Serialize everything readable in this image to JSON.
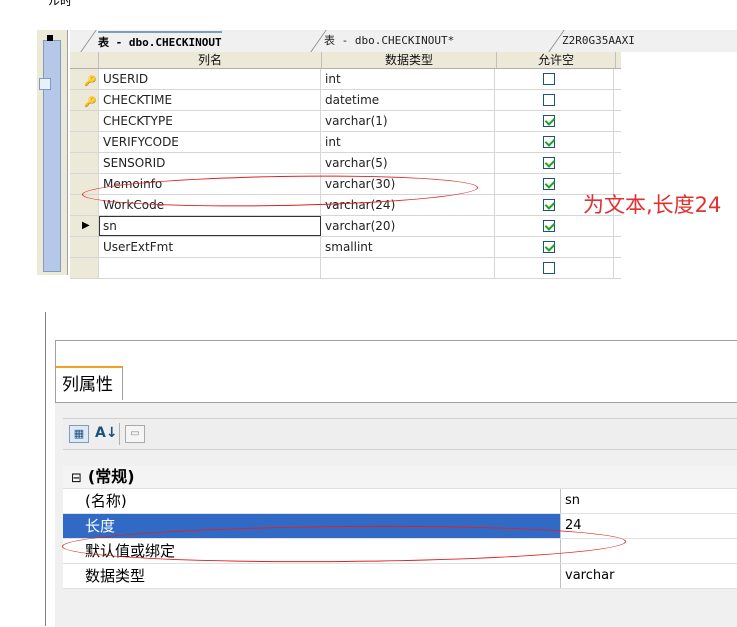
{
  "top_fragment": "ル时",
  "tabs": [
    {
      "label": "表 - dbo.CHECKINOUT",
      "active": true
    },
    {
      "label": "表 - dbo.CHECKINOUT*",
      "active": false
    },
    {
      "label": "Z2R0G35AAXI",
      "active": false
    }
  ],
  "grid": {
    "columns": [
      "列名",
      "数据类型",
      "允许空"
    ],
    "rows": [
      {
        "name": "USERID",
        "type": "int",
        "nullable": false,
        "marker": "key-icon"
      },
      {
        "name": "CHECKTIME",
        "type": "datetime",
        "nullable": false,
        "marker": "key-icon"
      },
      {
        "name": "CHECKTYPE",
        "type": "varchar(1)",
        "nullable": true,
        "marker": ""
      },
      {
        "name": "VERIFYCODE",
        "type": "int",
        "nullable": true,
        "marker": ""
      },
      {
        "name": "SENSORID",
        "type": "varchar(5)",
        "nullable": true,
        "marker": ""
      },
      {
        "name": "Memoinfo",
        "type": "varchar(30)",
        "nullable": true,
        "marker": ""
      },
      {
        "name": "WorkCode",
        "type": "varchar(24)",
        "nullable": true,
        "marker": ""
      },
      {
        "name": "sn",
        "type": "varchar(20)",
        "nullable": true,
        "marker": "arrow-icon"
      },
      {
        "name": "UserExtFmt",
        "type": "smallint",
        "nullable": true,
        "marker": ""
      },
      {
        "name": "",
        "type": "",
        "nullable": false,
        "marker": ""
      }
    ]
  },
  "annotation": "为文本,长度24",
  "properties": {
    "tab_label": "列属性",
    "section": "(常规)",
    "rows": [
      {
        "name": "(名称)",
        "value": "sn"
      },
      {
        "name": "长度",
        "value": "24"
      },
      {
        "name": "默认值或绑定",
        "value": ""
      },
      {
        "name": "数据类型",
        "value": "varchar"
      }
    ]
  },
  "colors": {
    "annotation": "#e03030",
    "selection": "#316ac5",
    "tab_accent": "#f2a01e"
  }
}
